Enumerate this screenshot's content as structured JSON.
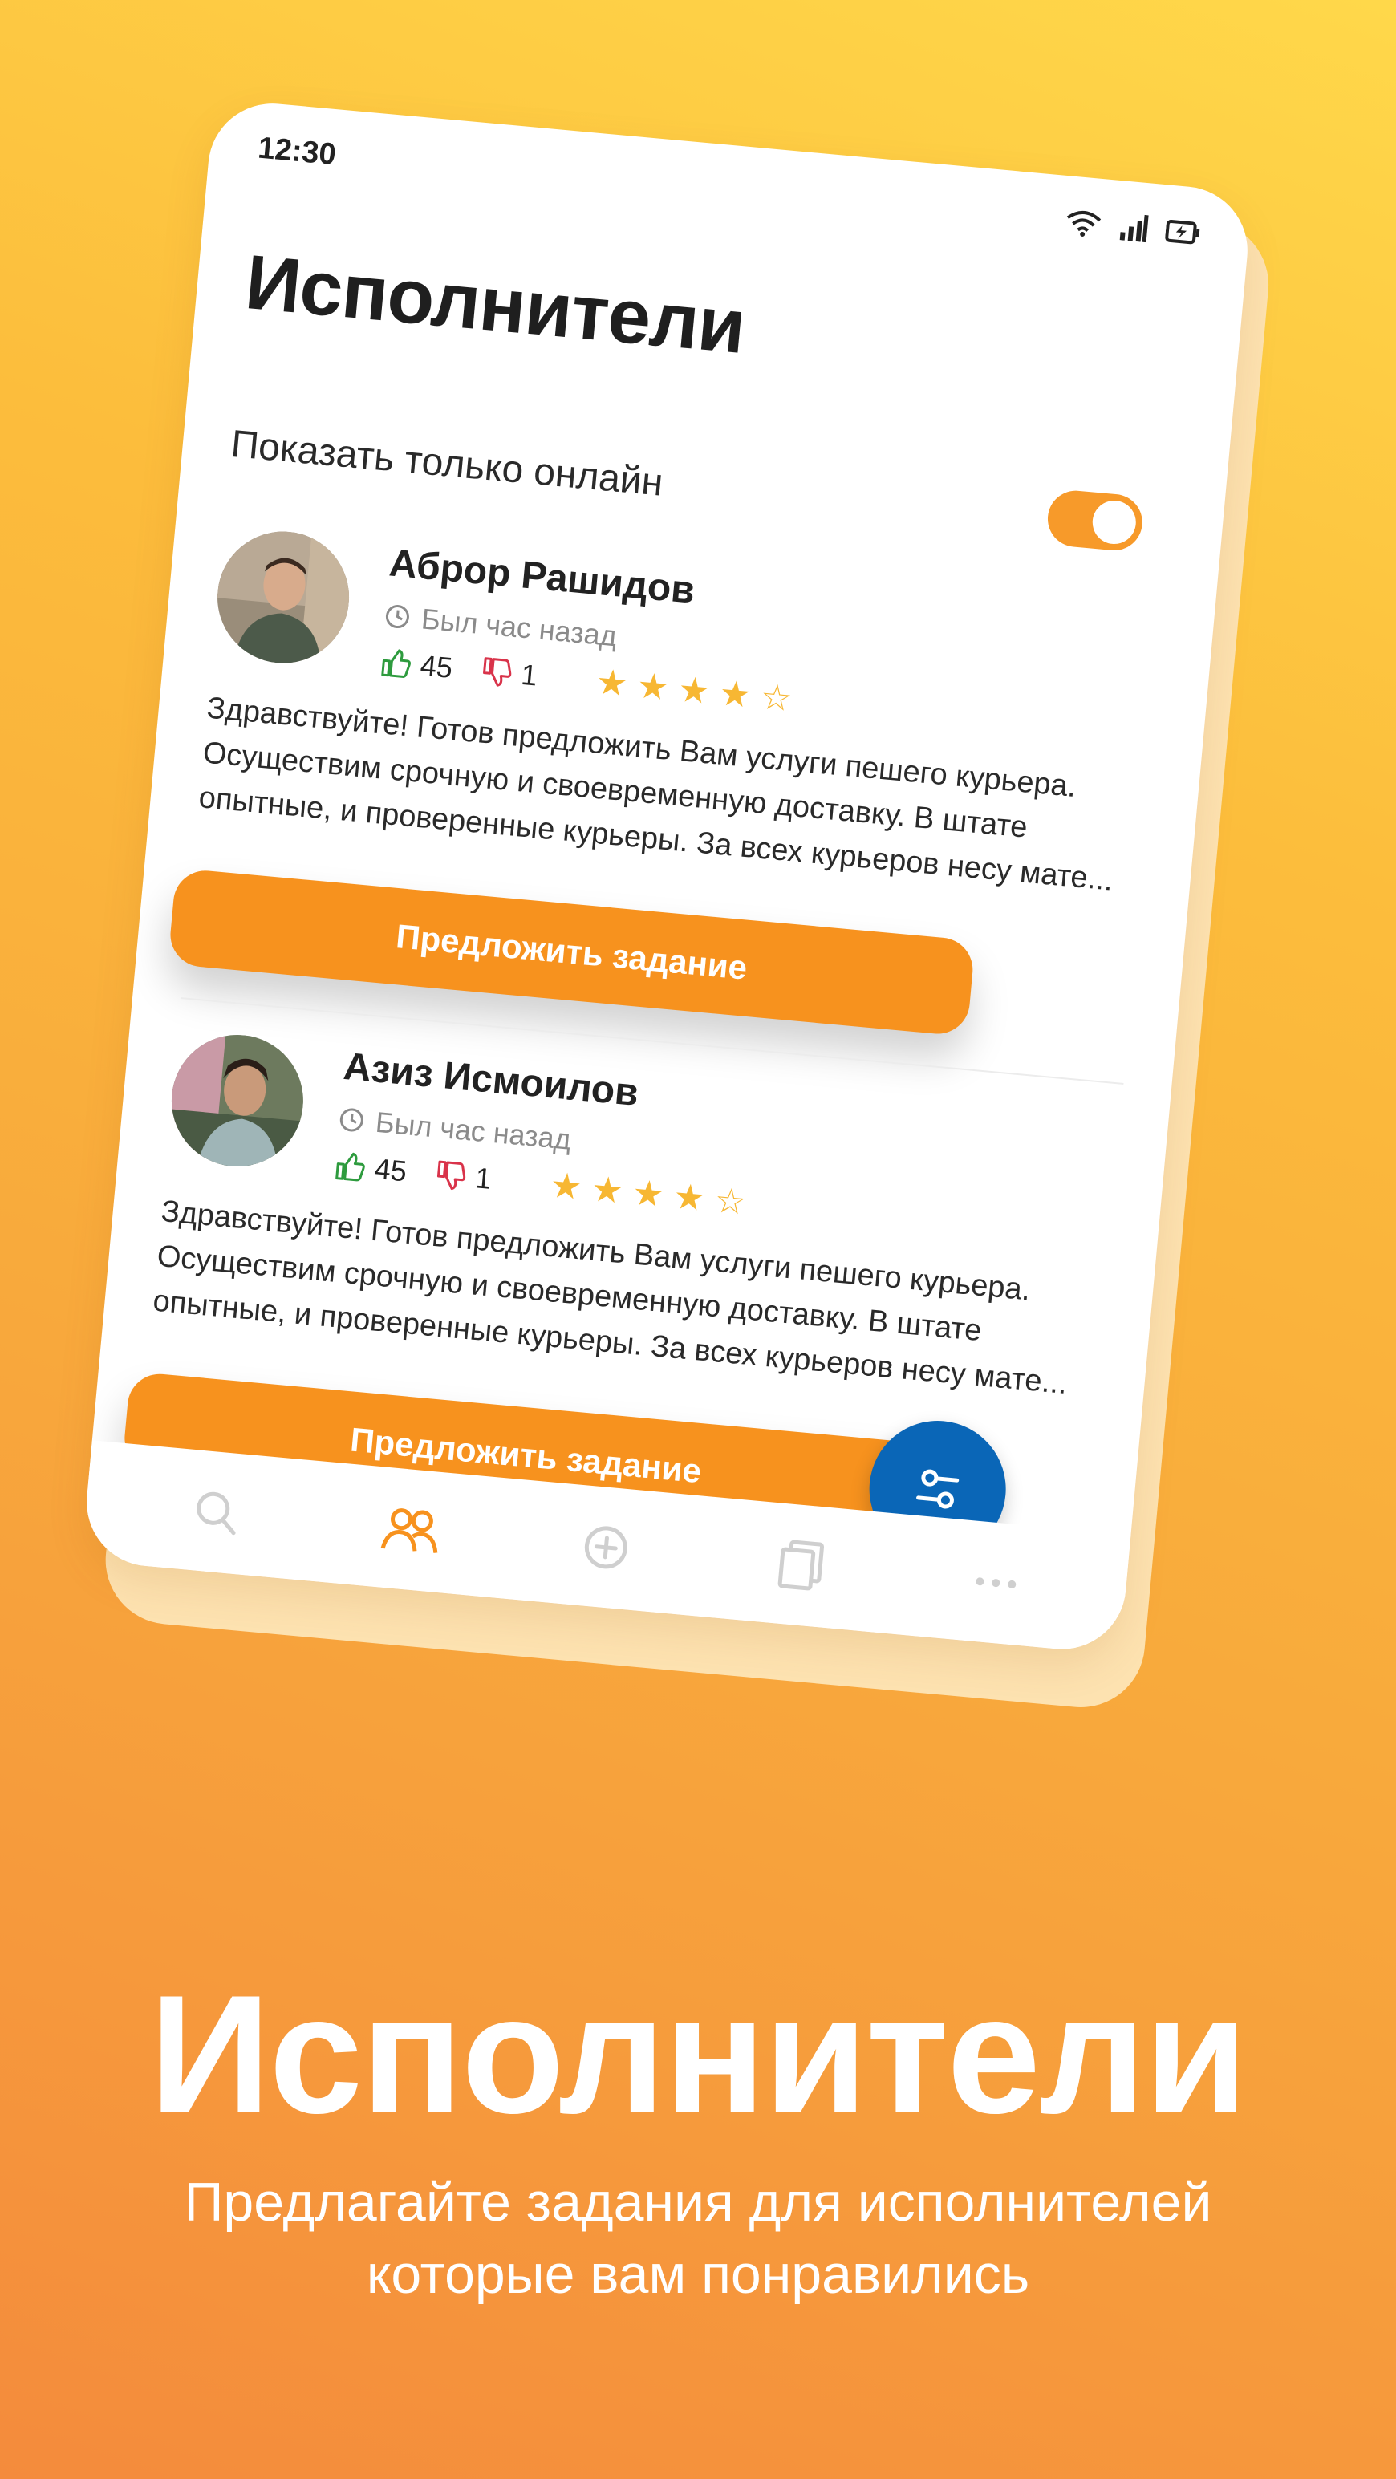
{
  "status_bar": {
    "time": "12:30"
  },
  "screen": {
    "title": "Исполнители",
    "online_toggle": {
      "label": "Показать только онлайн",
      "on": true
    }
  },
  "executors": [
    {
      "name": "Аброр Рашидов",
      "last_seen": "Был час назад",
      "likes": "45",
      "dislikes": "1",
      "rating": 4,
      "rating_max": 5,
      "description": "Здравствуйте! Готов предложить Вам услуги пешего курьера. Осуществим срочную и своевременную доставку. В штате опытные, и проверенные курьеры. За всех курьеров несу мате...",
      "button_label": "Предложить задание"
    },
    {
      "name": "Азиз Исмоилов",
      "last_seen": "Был час назад",
      "likes": "45",
      "dislikes": "1",
      "rating": 4,
      "rating_max": 5,
      "description": "Здравствуйте! Готов предложить Вам услуги пешего курьера. Осуществим срочную и своевременную доставку. В штате опытные, и проверенные курьеры. За всех курьеров несу мате...",
      "button_label": "Предложить задание"
    }
  ],
  "bottom_nav": [
    {
      "icon": "search-icon",
      "active": false
    },
    {
      "icon": "users-icon",
      "active": true
    },
    {
      "icon": "add-circle-icon",
      "active": false
    },
    {
      "icon": "documents-icon",
      "active": false
    },
    {
      "icon": "more-icon",
      "active": false
    }
  ],
  "fab": {
    "icon": "filter-icon"
  },
  "promo": {
    "headline": "Исполнители",
    "subline_1": "Предлагайте задания для исполнителей",
    "subline_2": "которые вам понравились"
  },
  "colors": {
    "accent": "#f7921e",
    "fab": "#0a66b7",
    "like": "#2e9b3e",
    "dislike": "#d9334a",
    "star": "#f7b733"
  }
}
